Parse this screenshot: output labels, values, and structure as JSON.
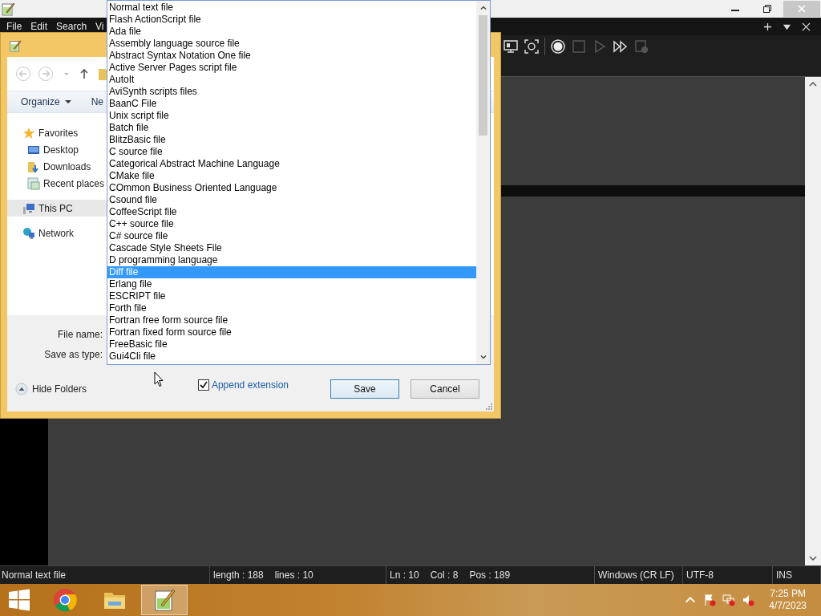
{
  "app_window": {
    "menu": [
      "File",
      "Edit",
      "Search",
      "Vi"
    ]
  },
  "status_bar": [
    {
      "items": [
        "Normal text file"
      ]
    },
    {
      "items": [
        "length : 188",
        "lines : 10"
      ]
    },
    {
      "items": [
        "Ln : 10",
        "Col : 8",
        "Pos : 189"
      ]
    },
    {
      "items": [
        "Windows (CR LF)"
      ]
    },
    {
      "items": [
        "UTF-8"
      ]
    },
    {
      "items": [
        "INS"
      ]
    }
  ],
  "save_dialog": {
    "command_bar": {
      "organize": "Organize",
      "new_folder": "Ne"
    },
    "nav_pane": [
      {
        "label": "Favorites",
        "kind": "favorites",
        "selected": false,
        "children": [
          {
            "label": "Desktop",
            "kind": "desktop",
            "selected": false
          },
          {
            "label": "Downloads",
            "kind": "downloads",
            "selected": false
          },
          {
            "label": "Recent places",
            "kind": "recent",
            "selected": false
          }
        ]
      },
      {
        "label": "This PC",
        "kind": "pc",
        "selected": true
      },
      {
        "label": "Network",
        "kind": "network",
        "selected": false
      }
    ],
    "file_name_label": "File name:",
    "save_type_label": "Save as type:",
    "hide_folders": "Hide Folders",
    "append_extension": {
      "label": "Append extension",
      "checked": true
    },
    "buttons": [
      {
        "label": "Save",
        "kind": "default"
      },
      {
        "label": "Cancel",
        "kind": "normal"
      }
    ]
  },
  "file_type_list": [
    {
      "label": "Normal text file",
      "selected": false
    },
    {
      "label": "Flash ActionScript file",
      "selected": false
    },
    {
      "label": "Ada file",
      "selected": false
    },
    {
      "label": "Assembly language source file",
      "selected": false
    },
    {
      "label": "Abstract Syntax Notation One file",
      "selected": false
    },
    {
      "label": "Active Server Pages script file",
      "selected": false
    },
    {
      "label": "AutoIt",
      "selected": false
    },
    {
      "label": "AviSynth scripts files",
      "selected": false
    },
    {
      "label": "BaanC File",
      "selected": false
    },
    {
      "label": "Unix script file",
      "selected": false
    },
    {
      "label": "Batch file",
      "selected": false
    },
    {
      "label": "BlitzBasic file",
      "selected": false
    },
    {
      "label": "C source file",
      "selected": false
    },
    {
      "label": "Categorical Abstract Machine Language",
      "selected": false
    },
    {
      "label": "CMake file",
      "selected": false
    },
    {
      "label": "COmmon Business Oriented Language",
      "selected": false
    },
    {
      "label": "Csound file",
      "selected": false
    },
    {
      "label": "CoffeeScript file",
      "selected": false
    },
    {
      "label": "C++ source file",
      "selected": false
    },
    {
      "label": "C# source file",
      "selected": false
    },
    {
      "label": "Cascade Style Sheets File",
      "selected": false
    },
    {
      "label": "D programming language",
      "selected": false
    },
    {
      "label": "Diff file",
      "selected": true
    },
    {
      "label": "Erlang file",
      "selected": false
    },
    {
      "label": "ESCRIPT file",
      "selected": false
    },
    {
      "label": "Forth file",
      "selected": false
    },
    {
      "label": "Fortran free form source file",
      "selected": false
    },
    {
      "label": "Fortran fixed form source file",
      "selected": false
    },
    {
      "label": "FreeBasic file",
      "selected": false
    },
    {
      "label": "Gui4Cli file",
      "selected": false
    }
  ],
  "taskbar": {
    "apps": [
      {
        "kind": "browser",
        "active": false
      },
      {
        "kind": "folder",
        "active": false
      },
      {
        "kind": "notepad",
        "active": true
      }
    ],
    "clock": {
      "time": "7:25 PM",
      "date": "4/7/2023"
    }
  }
}
